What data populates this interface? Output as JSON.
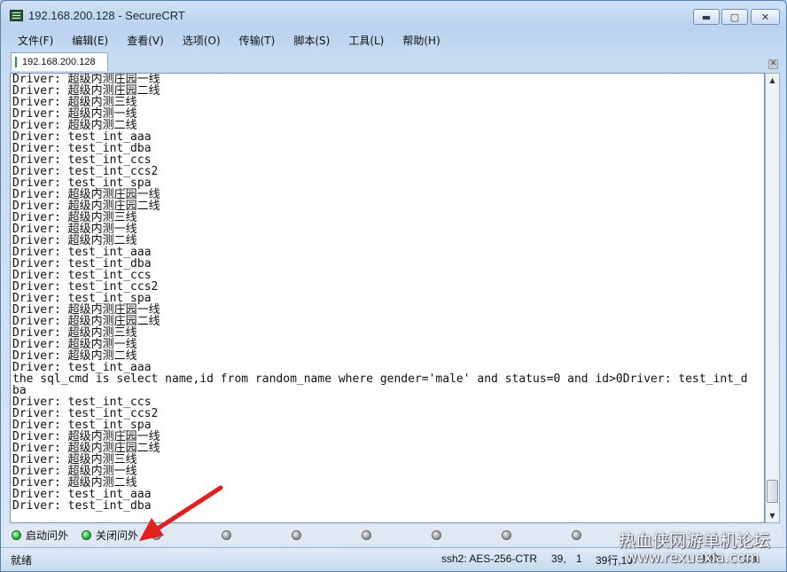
{
  "window": {
    "title": "192.168.200.128 - SecureCRT"
  },
  "window_controls": {
    "minimize": "▬",
    "maximize": "▢",
    "close": "✕"
  },
  "menu": [
    "文件(F)",
    "编辑(E)",
    "查看(V)",
    "选项(O)",
    "传输(T)",
    "脚本(S)",
    "工具(L)",
    "帮助(H)"
  ],
  "tab": {
    "label": "192.168.200.128",
    "close": "✕"
  },
  "terminal_lines": [
    "Driver: 超级内测庄园一线",
    "Driver: 超级内测庄园二线",
    "Driver: 超级内测三线",
    "Driver: 超级内测一线",
    "Driver: 超级内测二线",
    "Driver: test_int_aaa",
    "Driver: test_int_dba",
    "Driver: test_int_ccs",
    "Driver: test_int_ccs2",
    "Driver: test_int_spa",
    "Driver: 超级内测庄园一线",
    "Driver: 超级内测庄园二线",
    "Driver: 超级内测三线",
    "Driver: 超级内测一线",
    "Driver: 超级内测二线",
    "Driver: test_int_aaa",
    "Driver: test_int_dba",
    "Driver: test_int_ccs",
    "Driver: test_int_ccs2",
    "Driver: test_int_spa",
    "Driver: 超级内测庄园一线",
    "Driver: 超级内测庄园二线",
    "Driver: 超级内测三线",
    "Driver: 超级内测一线",
    "Driver: 超级内测二线",
    "Driver: test_int_aaa",
    "the sql_cmd is select name,id from random_name where gender='male' and status=0 and id>0Driver: test_int_d",
    "ba",
    "Driver: test_int_ccs",
    "Driver: test_int_ccs2",
    "Driver: test_int_spa",
    "Driver: 超级内测庄园一线",
    "Driver: 超级内测庄园二线",
    "Driver: 超级内测三线",
    "Driver: 超级内测一线",
    "Driver: 超级内测二线",
    "Driver: test_int_aaa",
    "Driver: test_int_dba"
  ],
  "button_bar": {
    "buttons": [
      {
        "label": "启动问外",
        "state": "green"
      },
      {
        "label": "关闭问外",
        "state": "green"
      },
      {
        "label": "",
        "state": "gray"
      },
      {
        "label": "",
        "state": "gray"
      },
      {
        "label": "",
        "state": "gray"
      },
      {
        "label": "",
        "state": "gray"
      },
      {
        "label": "",
        "state": "gray"
      },
      {
        "label": "",
        "state": "gray"
      },
      {
        "label": "",
        "state": "gray"
      }
    ]
  },
  "status": {
    "ready": "就绪",
    "cipher": "ssh2: AES-256-CTR",
    "row": "39,",
    "col": "1",
    "size": "39行,10",
    "extra1": "100",
    "extra2": "Ca"
  },
  "watermark": {
    "line1": "热血侠网游单机论坛",
    "line2": "www.rexuexia.com"
  },
  "colors": {
    "led_green": "#1fb33c",
    "led_gray": "#9a9a9a",
    "arrow": "#e02020"
  }
}
